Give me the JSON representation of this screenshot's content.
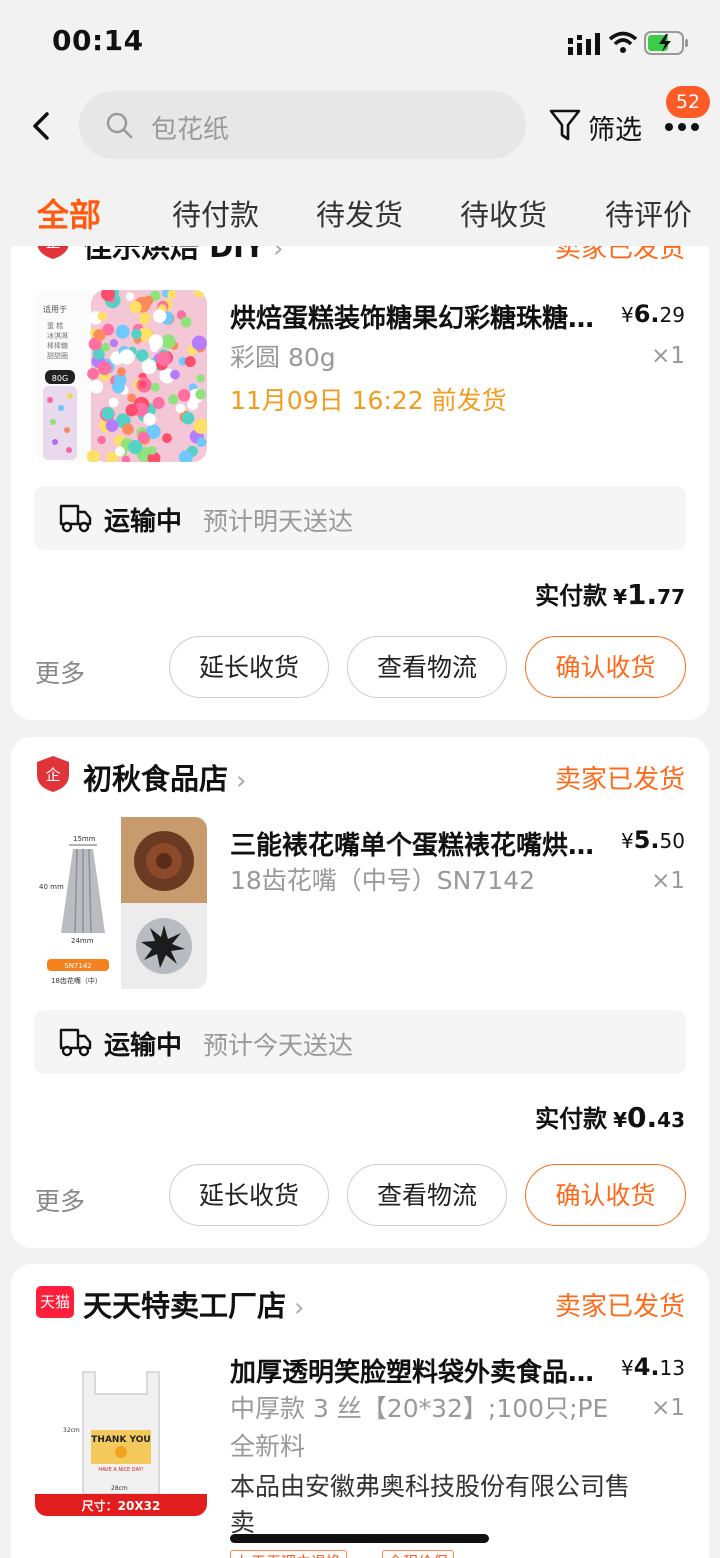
{
  "status_bar": {
    "time": "00:14"
  },
  "search": {
    "placeholder": "包花纸"
  },
  "filter": {
    "label": "筛选"
  },
  "more": {
    "badge": "52"
  },
  "tabs": [
    {
      "label": "全部",
      "active": true
    },
    {
      "label": "待付款"
    },
    {
      "label": "待发货"
    },
    {
      "label": "待收货"
    },
    {
      "label": "待评价"
    }
  ],
  "orders": [
    {
      "shop_name": "佳乐烘焙 DIY",
      "status": "卖家已发货",
      "product": {
        "title": "烘焙蛋糕装饰糖果幻彩糖珠糖…",
        "price_yen": "¥",
        "price_int": "6.",
        "price_dec": "29",
        "spec": "彩圆 80g",
        "qty": "×1",
        "ship_by": "11月09日 16:22 前发货",
        "thumb_text": [
          "适用于",
          "蛋 糕",
          "冰淇淋",
          "棒棒糖",
          "甜甜圈",
          "80G"
        ]
      },
      "logistics": {
        "state": "运输中",
        "eta": "预计明天送达"
      },
      "paid": {
        "label": "实付款",
        "yen": "¥",
        "int": "1.",
        "dec": "77"
      },
      "more_label": "更多",
      "buttons": [
        "延长收货",
        "查看物流",
        "确认收货"
      ]
    },
    {
      "shop_name": "初秋食品店",
      "status": "卖家已发货",
      "product": {
        "title": "三能裱花嘴单个蛋糕裱花嘴烘…",
        "price_yen": "¥",
        "price_int": "5.",
        "price_dec": "50",
        "spec": "18齿花嘴（中号）SN7142",
        "qty": "×1",
        "thumb_text": [
          "15mm",
          "40 mm",
          "24mm",
          "SN7142",
          "18齿花嘴（中）"
        ]
      },
      "logistics": {
        "state": "运输中",
        "eta": "预计今天送达"
      },
      "paid": {
        "label": "实付款",
        "yen": "¥",
        "int": "0.",
        "dec": "43"
      },
      "more_label": "更多",
      "buttons": [
        "延长收货",
        "查看物流",
        "确认收货"
      ]
    },
    {
      "shop_name": "天天特卖工厂店",
      "shop_badge": "天猫",
      "status": "卖家已发货",
      "product": {
        "title": "加厚透明笑脸塑料袋外卖食品…",
        "price_yen": "¥",
        "price_int": "4.",
        "price_dec": "13",
        "spec": "中厚款 3 丝【20*32】;100只;PE 全新料",
        "qty": "×1",
        "note": "本品由安徽弗奥科技股份有限公司售卖",
        "tags": [
          "七天无理由退换",
          "全程价保"
        ],
        "thumb_text": [
          "THANK YOU",
          "HAVE A NICE DAY!",
          "32cm",
          "28cm",
          "尺寸：20X32"
        ]
      }
    }
  ],
  "colors": {
    "accent": "#ff5a0f",
    "ship": "#f29b1f",
    "badge": "#ff5b26",
    "shop_logo": "#e0343a"
  }
}
